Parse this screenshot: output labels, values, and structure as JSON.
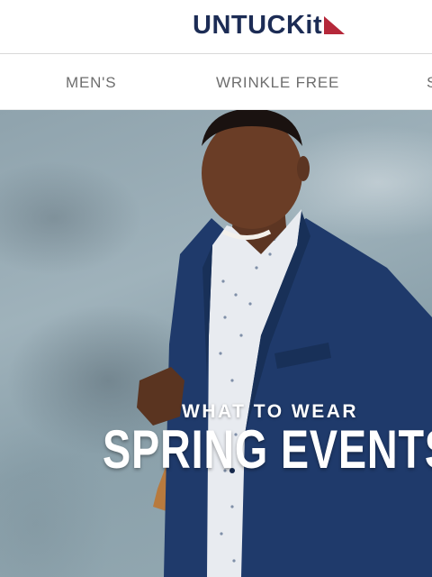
{
  "header": {
    "logo_text": "UNTUCKit",
    "logo_icon": "red-triangle-logo-mark",
    "brand_color": "#1c2c55",
    "accent_color": "#b5283a"
  },
  "nav": {
    "items": [
      {
        "label": "MEN'S"
      },
      {
        "label": "WRINKLE FREE"
      },
      {
        "label": "S"
      }
    ]
  },
  "hero": {
    "kicker": "WHAT TO WEAR",
    "headline": "SPRING EVENTS"
  }
}
